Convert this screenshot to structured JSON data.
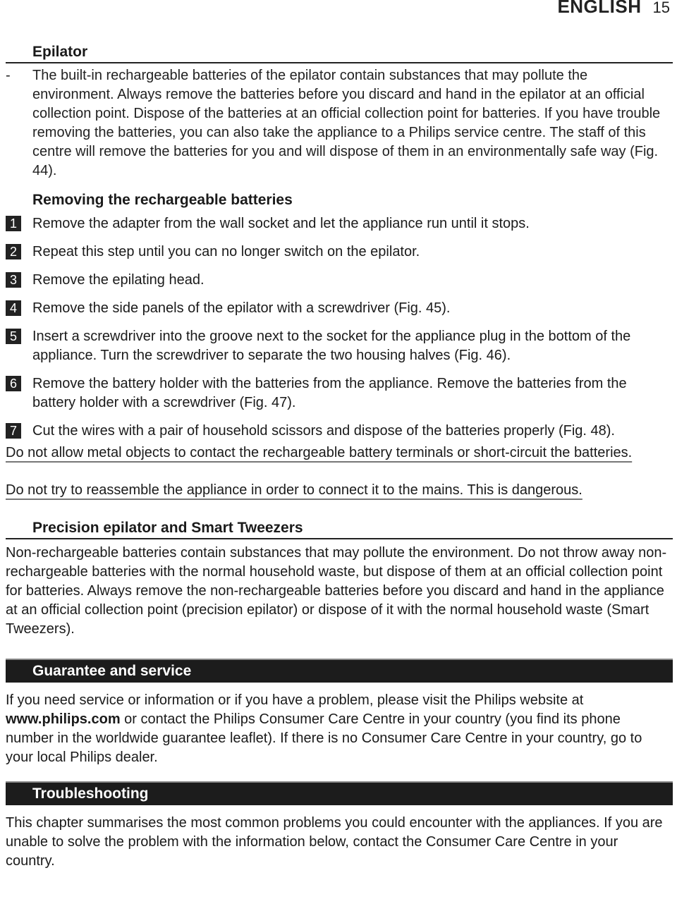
{
  "header": {
    "language": "ENGLISH",
    "page_number": "15"
  },
  "epilator": {
    "title": "Epilator",
    "bullet_marker": "-",
    "bullet_text": "The built-in rechargeable batteries of the epilator contain substances that may pollute the environment. Always remove the batteries before you discard and hand in the epilator at an official collection point. Dispose of the batteries at an official collection point for batteries. If you have trouble removing the batteries, you can also take the appliance to a Philips service centre. The staff of this centre will remove the batteries for you and will dispose of them in an environmentally safe way (Fig. 44).",
    "subtitle": "Removing the rechargeable batteries",
    "steps": [
      {
        "number": "1",
        "text": "Remove the adapter from the wall socket and let the appliance run until it stops."
      },
      {
        "number": "2",
        "text": "Repeat this step until you can no longer switch on the epilator."
      },
      {
        "number": "3",
        "text": "Remove the epilating head."
      },
      {
        "number": "4",
        "text": "Remove the side panels of the epilator with a screwdriver (Fig. 45)."
      },
      {
        "number": "5",
        "text": "Insert a screwdriver into the groove next to the socket for the appliance plug in the bottom of the appliance. Turn the screwdriver to separate the two housing halves (Fig. 46)."
      },
      {
        "number": "6",
        "text": "Remove the battery holder with the batteries from the appliance. Remove the batteries from the battery holder with a screwdriver (Fig. 47)."
      },
      {
        "number": "7",
        "text": "Cut the wires with a pair of household scissors and dispose of the batteries properly (Fig. 48)."
      }
    ],
    "warnings": [
      "Do not allow metal objects to contact the rechargeable battery terminals or short-circuit the batteries.",
      "Do not try to reassemble the appliance in order to connect it to the mains. This is dangerous."
    ]
  },
  "precision": {
    "title": "Precision epilator and Smart Tweezers",
    "text": "Non-rechargeable batteries contain substances that may pollute the environment. Do not throw away non-rechargeable batteries with the normal household waste, but dispose of them at an official collection point for batteries. Always remove the non-rechargeable batteries before you discard and hand in the appliance at an official collection point (precision epilator) or dispose of it with the normal household waste (Smart Tweezers)."
  },
  "guarantee": {
    "title": "Guarantee and service",
    "text_before": "If you need service or information or if you have a problem, please visit the Philips website at ",
    "link": "www.philips.com",
    "text_after": " or contact the Philips Consumer Care Centre in your country (you find its phone number in the worldwide guarantee leaflet). If there is no Consumer Care Centre in your country, go to your local Philips dealer."
  },
  "troubleshooting": {
    "title": "Troubleshooting",
    "text": "This chapter summarises the most common problems you could encounter with the appliances. If you are unable to solve the problem with the information below, contact the Consumer Care Centre in your country."
  }
}
